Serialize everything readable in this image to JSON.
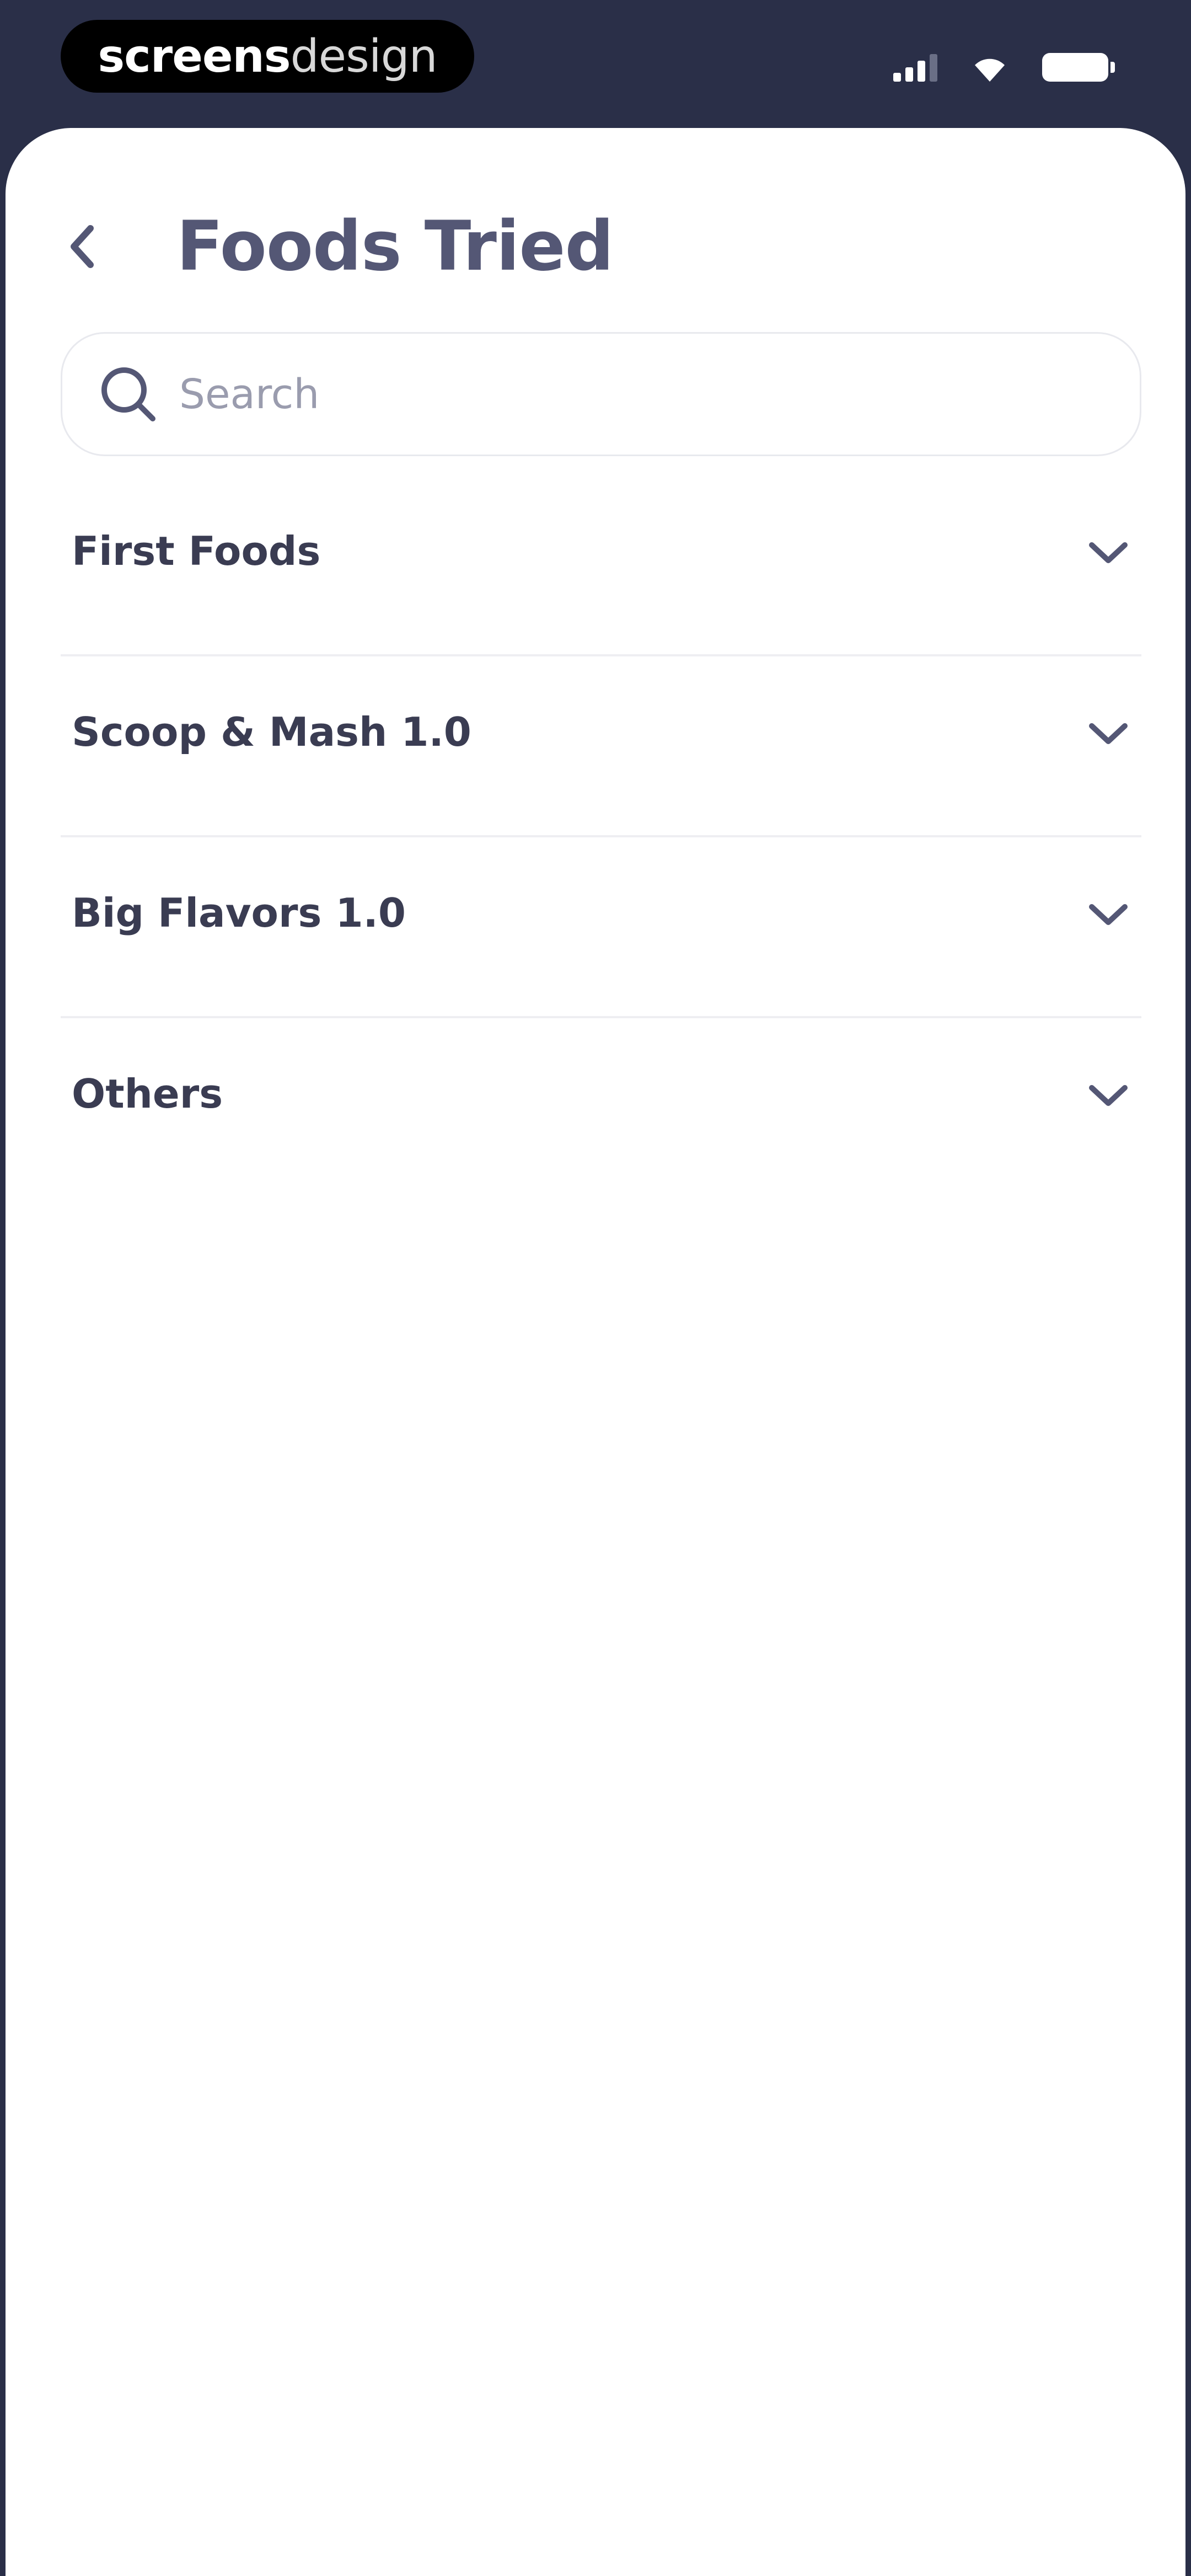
{
  "watermark": {
    "part1": "screens",
    "part2": "design"
  },
  "header": {
    "title": "Foods Tried"
  },
  "search": {
    "placeholder": "Search"
  },
  "categories": [
    {
      "label": "First Foods"
    },
    {
      "label": "Scoop & Mash 1.0"
    },
    {
      "label": "Big Flavors 1.0"
    },
    {
      "label": "Others"
    }
  ],
  "icons": {
    "back": "chevron-left-icon",
    "search": "search-icon",
    "expand": "chevron-down-icon"
  },
  "colors": {
    "status_bar": "#2a2f48",
    "title": "#545775",
    "row_text": "#3a3c52",
    "placeholder": "#9a9cae"
  }
}
